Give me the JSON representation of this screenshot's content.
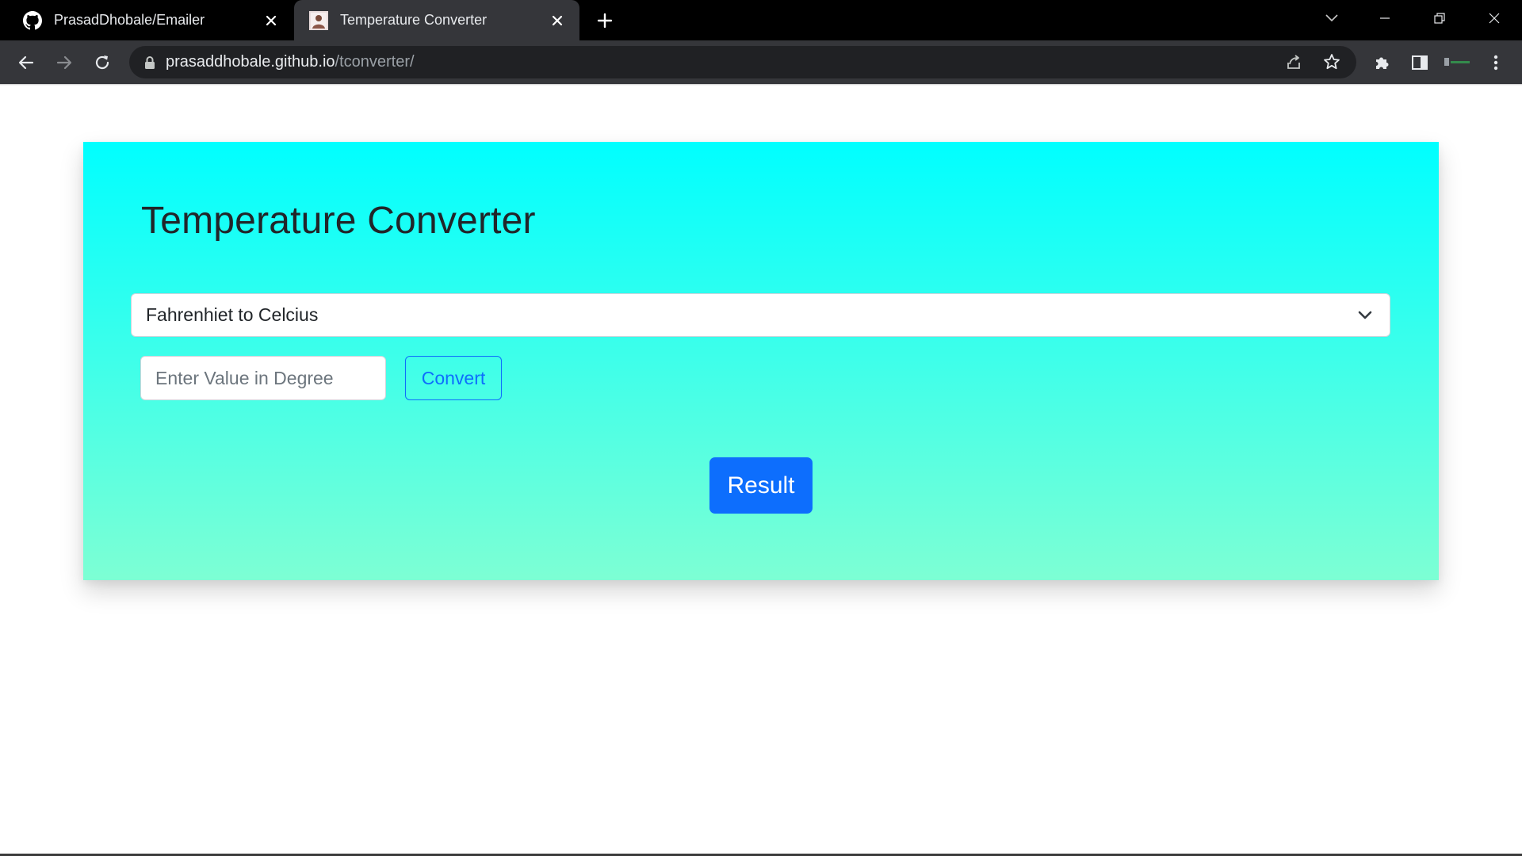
{
  "browser": {
    "tabs": [
      {
        "title": "PrasadDhobale/Emailer",
        "icon": "github-icon",
        "active": false
      },
      {
        "title": "Temperature Converter",
        "icon": "profile-photo-icon",
        "active": true
      }
    ],
    "url": {
      "host": "prasaddhobale.github.io",
      "path": "/tconverter/"
    }
  },
  "page": {
    "title": "Temperature Converter",
    "conversion_select": {
      "selected": "Fahrenhiet to Celcius"
    },
    "degree_input": {
      "value": "",
      "placeholder": "Enter Value in Degree"
    },
    "convert_label": "Convert",
    "result_label": "Result"
  },
  "colors": {
    "card_gradient_top": "#00ffff",
    "card_gradient_bottom": "#7dffd4",
    "primary": "#0d6efd",
    "title_text": "#212529"
  }
}
